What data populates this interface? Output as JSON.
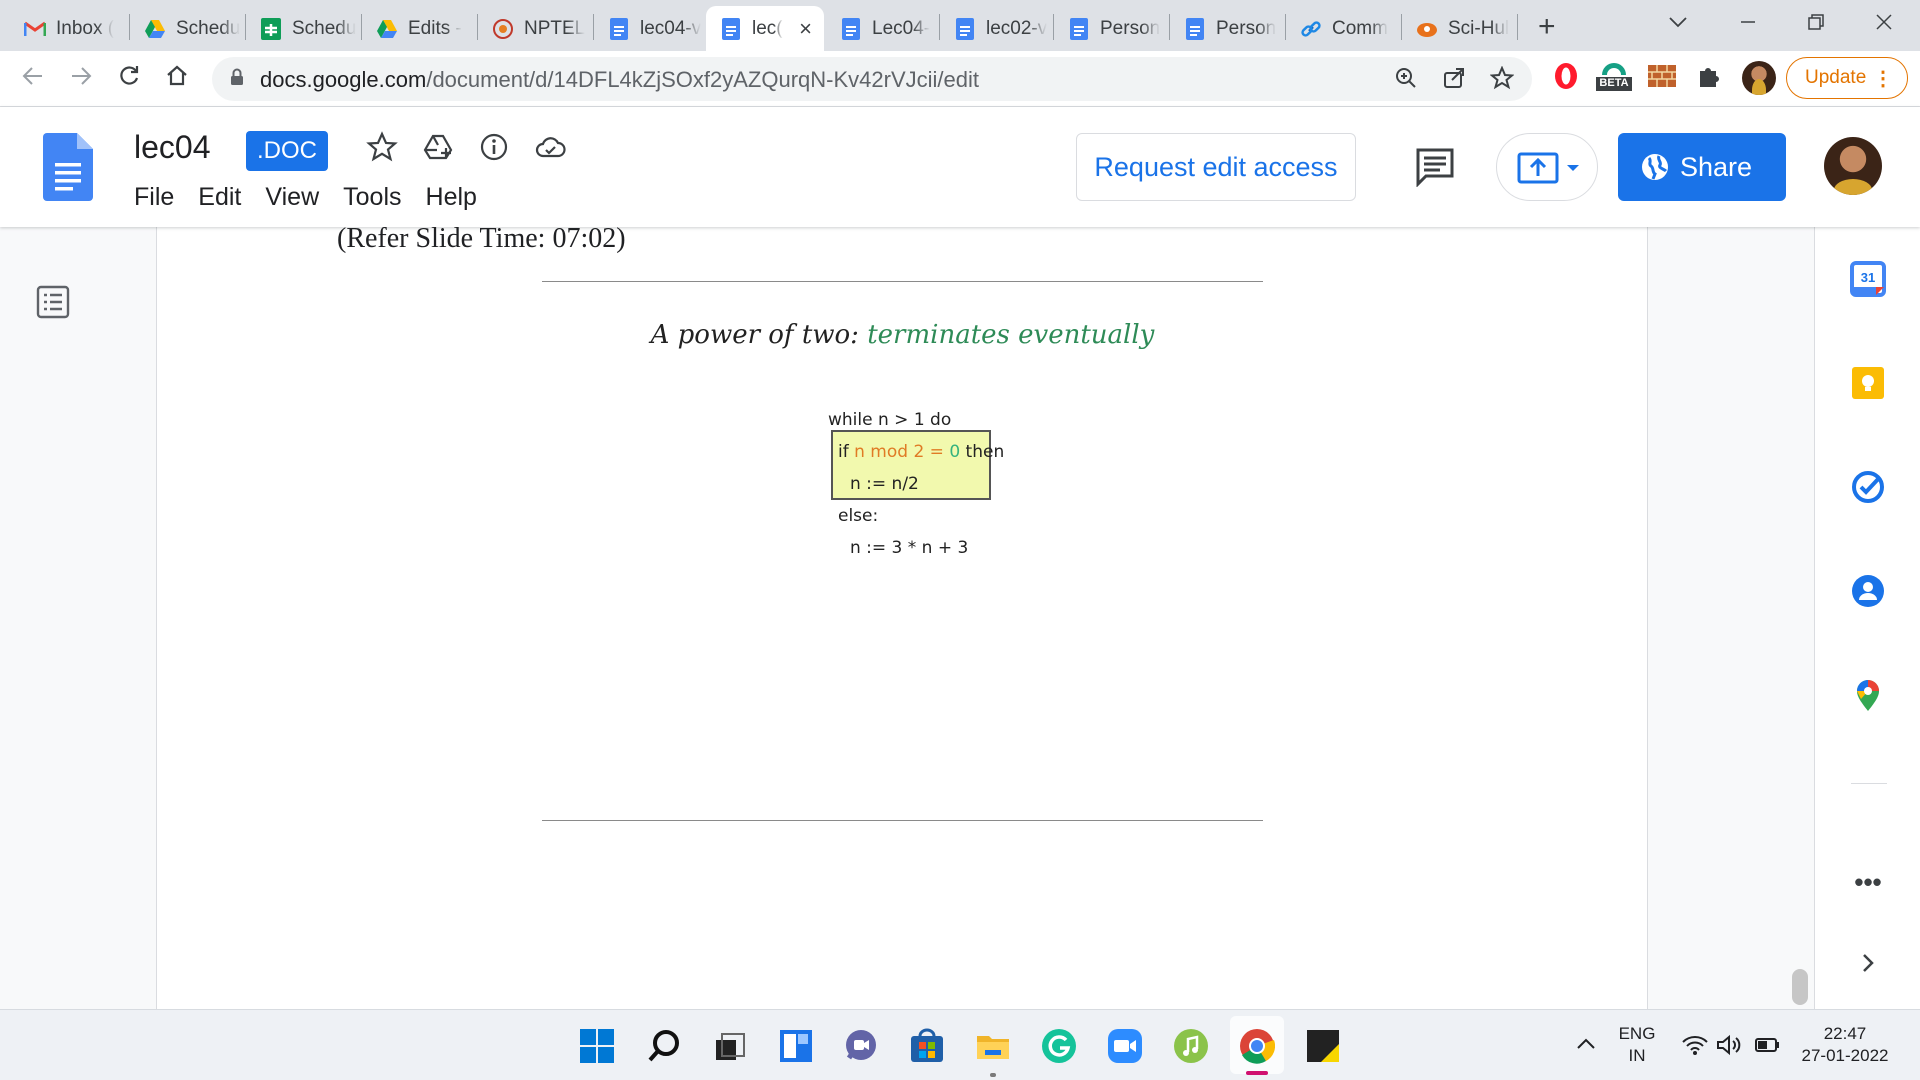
{
  "browser": {
    "tabs": [
      {
        "title": "Inbox (",
        "icon": "gmail-icon"
      },
      {
        "title": "Schedu",
        "icon": "google-drive-icon"
      },
      {
        "title": "Schedu",
        "icon": "google-sheets-icon"
      },
      {
        "title": "Edits -",
        "icon": "google-drive-icon"
      },
      {
        "title": "NPTEL",
        "icon": "nptel-icon"
      },
      {
        "title": "lec04-v",
        "icon": "google-docs-icon"
      },
      {
        "title": "lec(",
        "icon": "google-docs-icon",
        "active": true
      },
      {
        "title": "Lec04-",
        "icon": "google-docs-icon"
      },
      {
        "title": "lec02-v",
        "icon": "google-docs-icon"
      },
      {
        "title": "Person",
        "icon": "google-docs-icon"
      },
      {
        "title": "Person",
        "icon": "google-docs-icon"
      },
      {
        "title": "Comm",
        "icon": "link-icon"
      },
      {
        "title": "Sci-Hul",
        "icon": "sci-hub-icon"
      }
    ],
    "url_host": "docs.google.com",
    "url_path": "/document/d/14DFL4kZjSOxf2yAZQurqN-Kv42rVJcii/edit",
    "beta_badge": "BETA",
    "update_label": "Update"
  },
  "docs": {
    "title": "lec04",
    "badge": ".DOC",
    "menu": [
      "File",
      "Edit",
      "View",
      "Tools",
      "Help"
    ],
    "request_access_label": "Request edit access",
    "share_label": "Share",
    "brand_color": "#1a73e8"
  },
  "document": {
    "refer_text": "(Refer Slide Time: 07:02)",
    "slide": {
      "title_part1": "A power of two: ",
      "title_part2": "terminates eventually",
      "code": {
        "line1": "while n > 1 do",
        "if_kw": "if ",
        "cond": "n mod 2 = ",
        "zero": "0",
        "then_kw": " then",
        "line3": "n := n/2",
        "line4": "else:",
        "line5": "n := 3 * n + 3"
      },
      "highlight_color": "#f2f9ae"
    }
  },
  "side_panel": [
    "google-calendar-icon",
    "google-keep-icon",
    "google-tasks-icon",
    "google-contacts-icon",
    "google-maps-icon"
  ],
  "calendar_day": "31",
  "taskbar": {
    "language": "ENG",
    "region": "IN",
    "time": "22:47",
    "date": "27-01-2022"
  }
}
